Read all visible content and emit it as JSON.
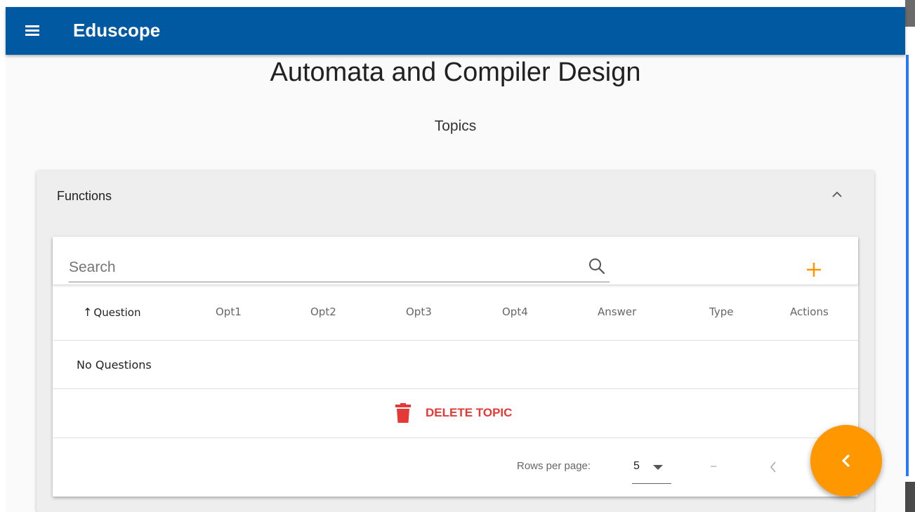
{
  "app": {
    "brand": "Eduscope"
  },
  "page": {
    "title": "Automata and Compiler Design",
    "section": "Topics"
  },
  "topic": {
    "name": "Functions",
    "search": {
      "placeholder": "Search",
      "value": ""
    },
    "columns": [
      "Question",
      "Opt1",
      "Opt2",
      "Opt3",
      "Opt4",
      "Answer",
      "Type",
      "Actions"
    ],
    "sort": {
      "column": "Question",
      "direction": "ascending",
      "indicator": "↑"
    },
    "empty_message": "No Questions",
    "delete_label": "DELETE TOPIC"
  },
  "pagination": {
    "rows_per_page_label": "Rows per page:",
    "rows_per_page": "5",
    "range": "–"
  },
  "icons": {
    "menu": "menu-icon",
    "search": "search-icon",
    "add": "plus-icon",
    "collapse": "chevron-up-icon",
    "sort": "arrow-up-icon",
    "delete": "trash-icon",
    "dropdown": "caret-down-icon",
    "prev": "chevron-left-icon",
    "fab": "chevron-left-icon"
  },
  "colors": {
    "appbar": "#0059a1",
    "accent": "#ff9800",
    "danger": "#e53935",
    "panel": "#eeeeee"
  }
}
